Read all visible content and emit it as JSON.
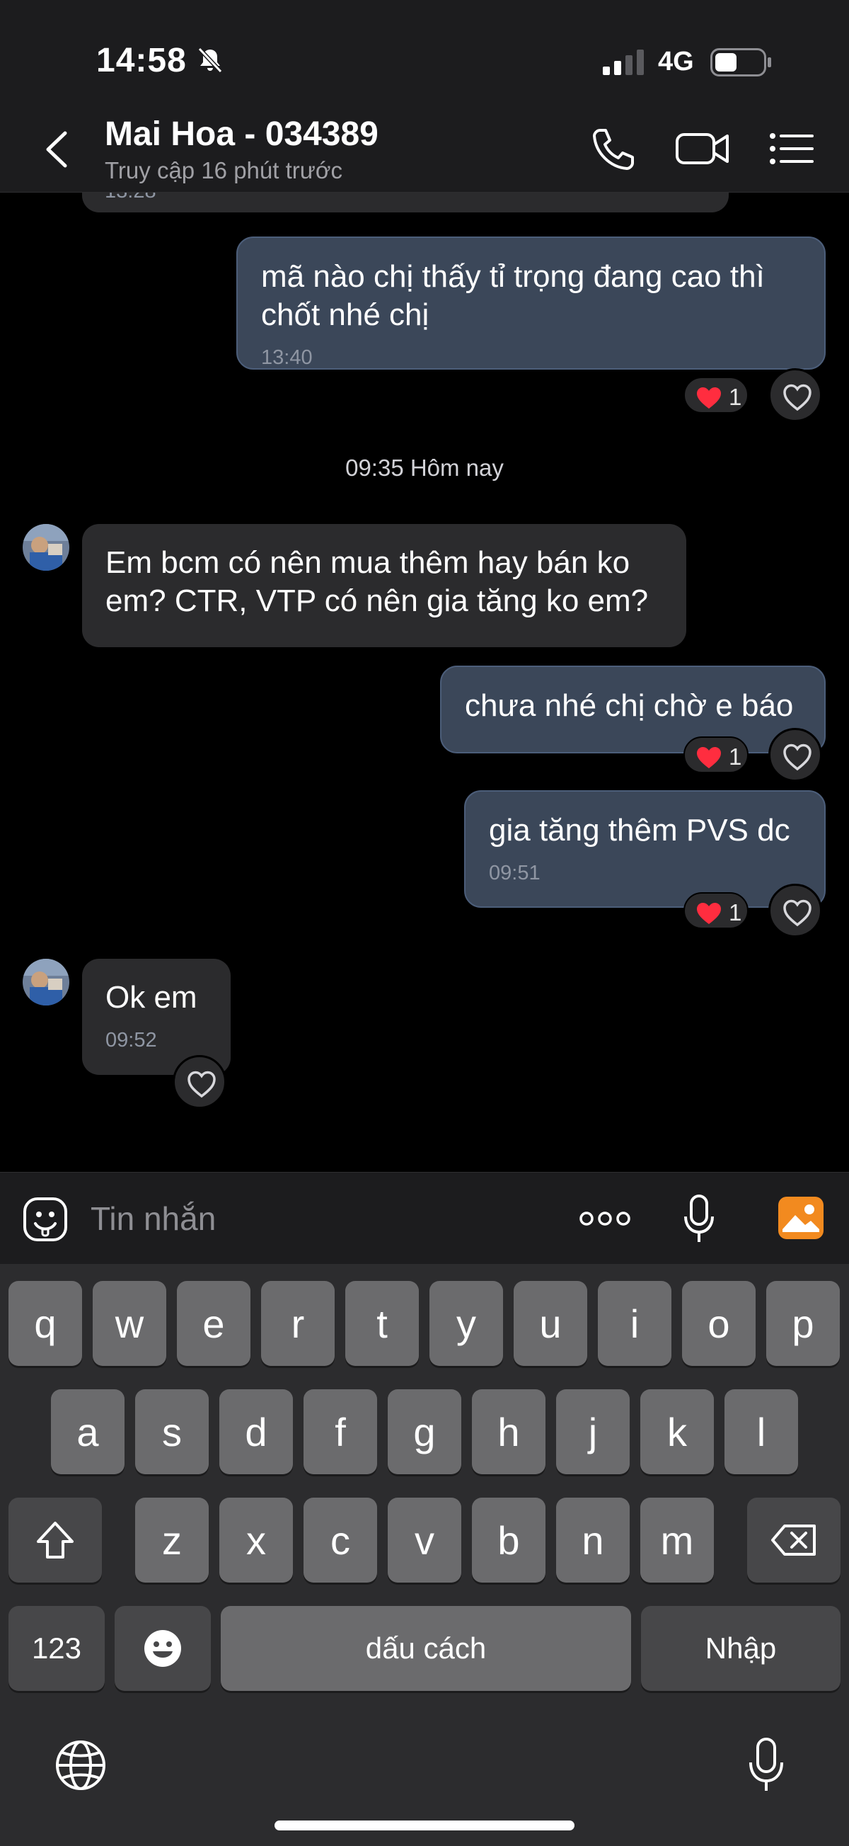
{
  "status_bar": {
    "time": "14:58",
    "network": "4G",
    "icons": [
      "bell-slash-icon",
      "signal-icon",
      "battery-icon"
    ]
  },
  "header": {
    "name": "Mai Hoa - 034389",
    "status": "Truy cập 16 phút trước",
    "icons": [
      "back-icon",
      "phone-icon",
      "video-icon",
      "menu-icon"
    ]
  },
  "chat": {
    "partial_time": "13:28",
    "date_divider": "09:35 Hôm nay",
    "messages": [
      {
        "from": "me",
        "lines": [
          "mã nào chị thấy tỉ trọng đang cao thì",
          "chốt nhé chị"
        ],
        "time": "13:40",
        "reaction": "1"
      },
      {
        "from": "contact",
        "lines": [
          "Em bcm có nên mua thêm hay bán ko",
          "em? CTR, VTP có nên gia tăng ko em?"
        ]
      },
      {
        "from": "me",
        "lines": [
          "chưa nhé chị chờ e báo"
        ],
        "reaction": "1"
      },
      {
        "from": "me",
        "lines": [
          "gia tăng thêm PVS dc"
        ],
        "time": "09:51",
        "reaction": "1"
      },
      {
        "from": "contact",
        "lines": [
          "Ok em"
        ],
        "time": "09:52"
      }
    ],
    "heart_color": "#ff2d3f"
  },
  "composer": {
    "placeholder": "Tin nhắn",
    "icons": [
      "emoji-icon",
      "more-icon",
      "mic-icon",
      "photo-icon"
    ],
    "photo_color": "#f28a1f"
  },
  "keyboard": {
    "row1": [
      "q",
      "w",
      "e",
      "r",
      "t",
      "y",
      "u",
      "i",
      "o",
      "p"
    ],
    "row2": [
      "a",
      "s",
      "d",
      "f",
      "g",
      "h",
      "j",
      "k",
      "l"
    ],
    "row3": [
      "z",
      "x",
      "c",
      "v",
      "b",
      "n",
      "m"
    ],
    "numbers": "123",
    "space": "dấu cách",
    "enter": "Nhập",
    "icons": [
      "shift-icon",
      "backspace-icon",
      "emoji-key-icon",
      "globe-icon",
      "dictation-icon"
    ]
  }
}
